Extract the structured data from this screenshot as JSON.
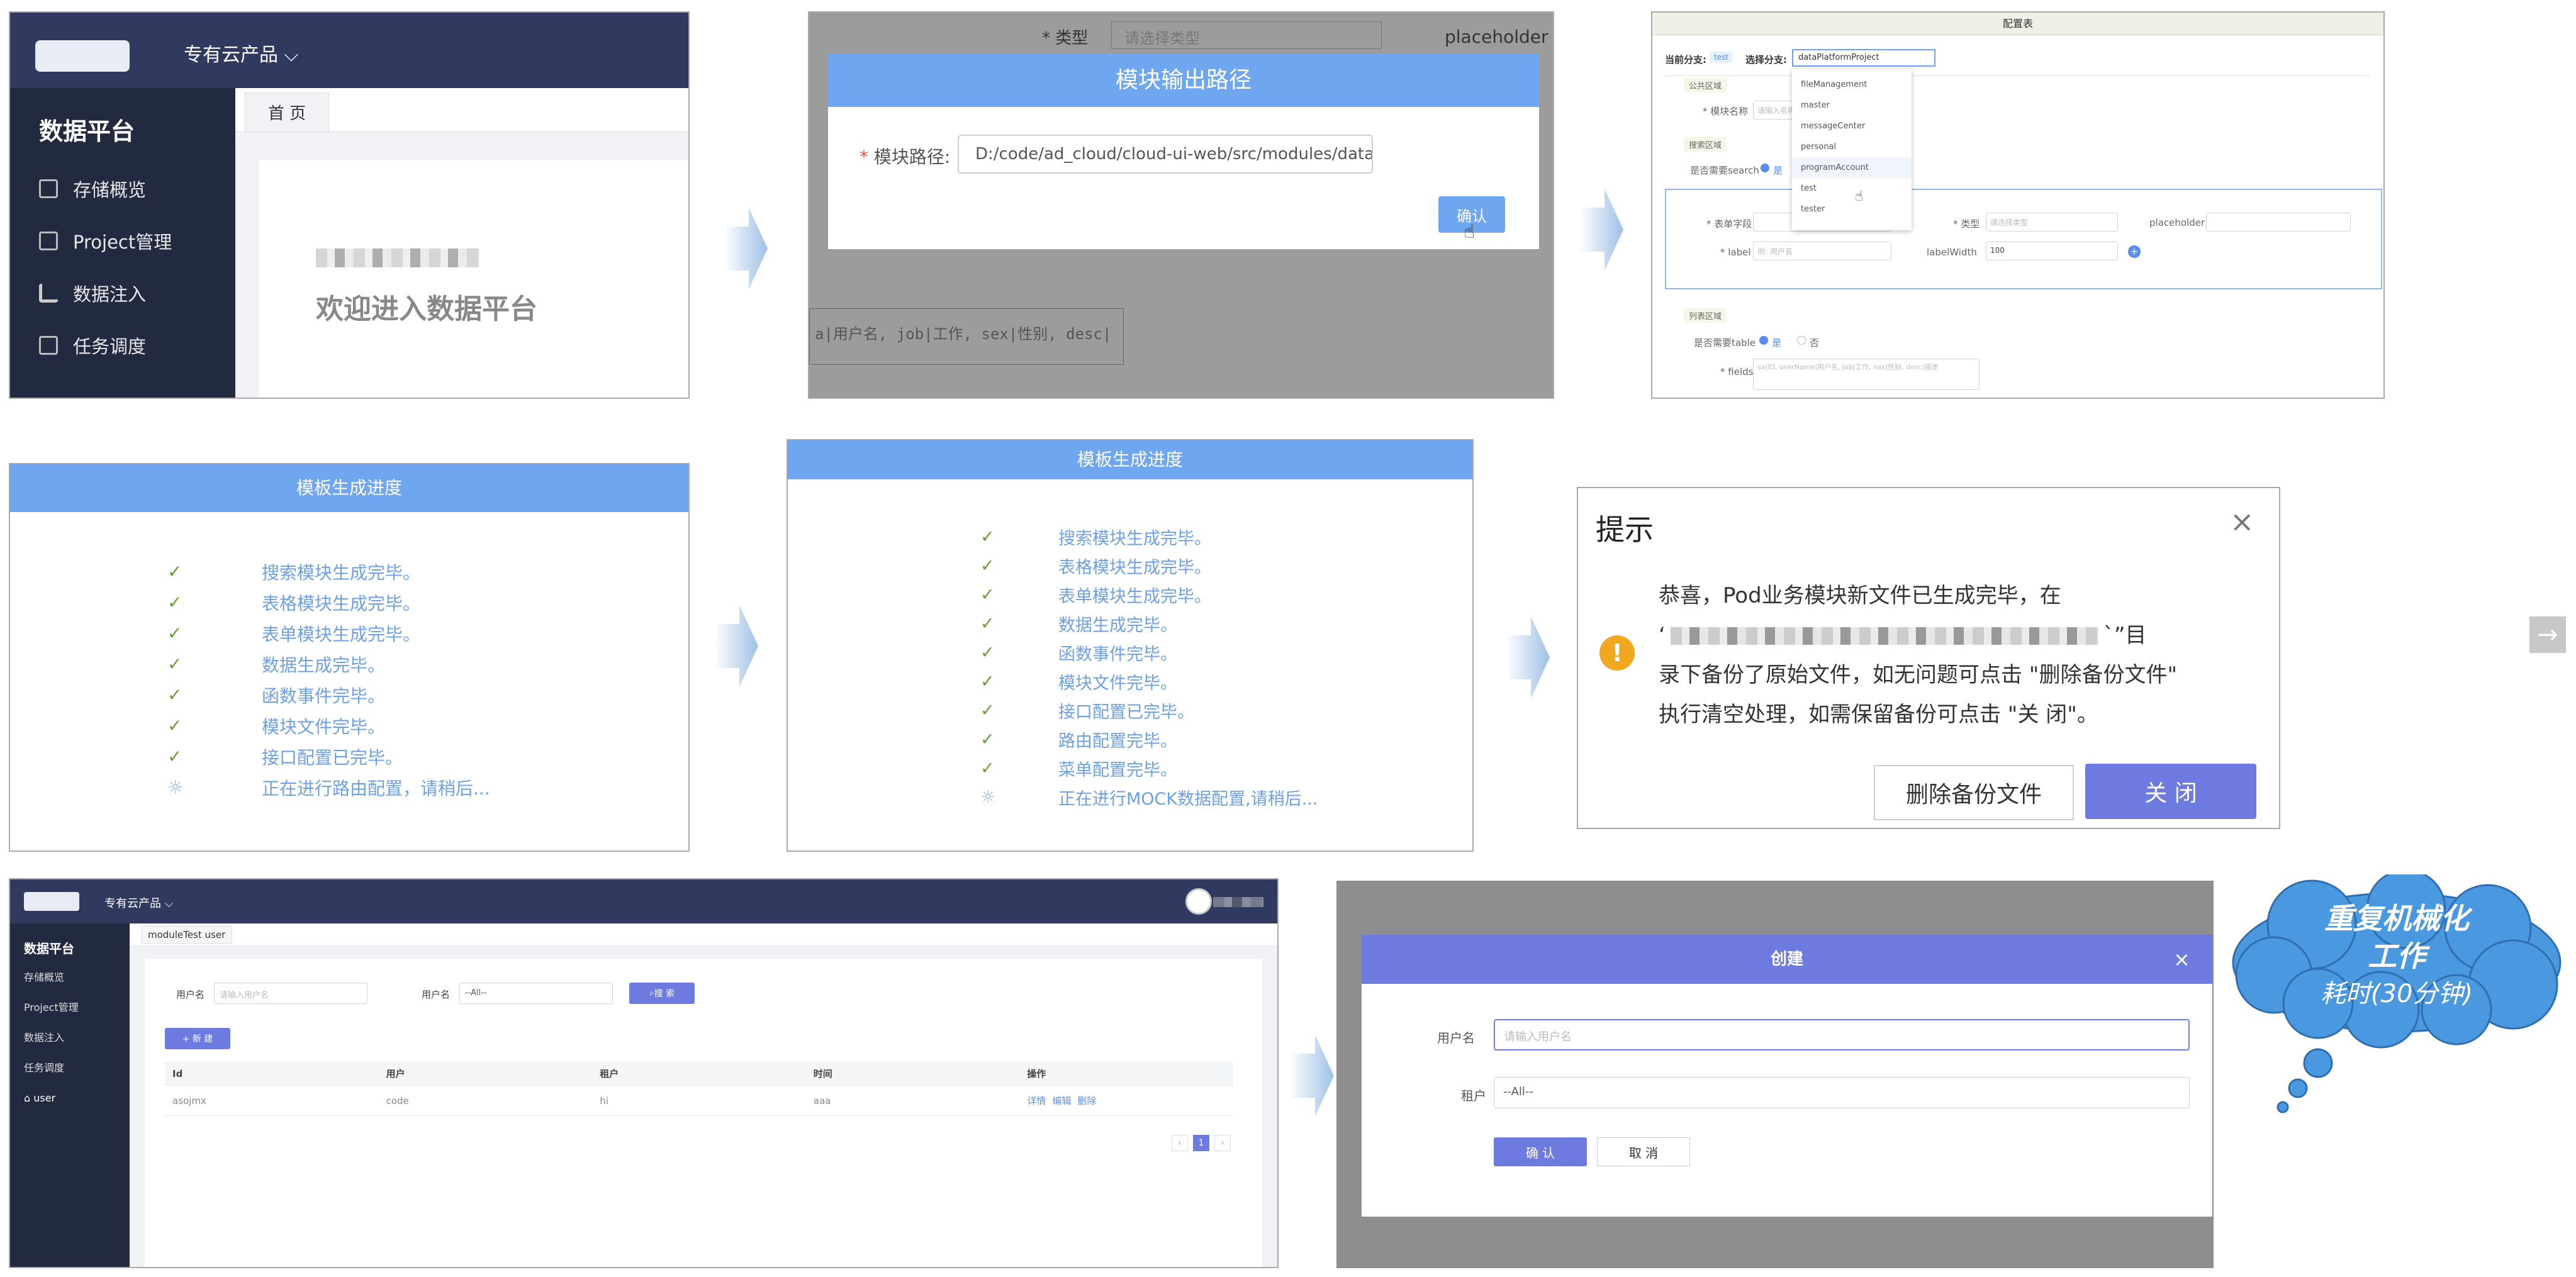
{
  "nav": {
    "prev": "←",
    "next": "→"
  },
  "panel1": {
    "product_menu": "专有云产品 ⌵",
    "side_title": "数据平台",
    "side_items": [
      "存储概览",
      "Project管理",
      "数据注入",
      "任务调度"
    ],
    "tab": "首 页",
    "welcome": "欢迎进入数据平台"
  },
  "panel2": {
    "bg_type_label": "* 类型",
    "bg_type_placeholder": "请选择类型",
    "bg_placeholder": "placeholder",
    "bg_fields": "a|用户名, job|工作, sex|性别, desc|",
    "dialog_title": "模块输出路径",
    "path_label": "模块路径:",
    "path_value": "D:/code/ad_cloud/cloud-ui-web/src/modules/data/pages",
    "confirm": "确认"
  },
  "panel3": {
    "title": "配置表",
    "current_branch_label": "当前分支:",
    "current_branch": "test",
    "select_branch_label": "选择分支:",
    "select_branch": "dataPlatformProject",
    "sections": [
      "公共区域",
      "搜索区域",
      "列表区域"
    ],
    "module_name_label": "* 模块名称",
    "module_name_ph": "请输入名称",
    "search_label": "是否需要search",
    "yes": "是",
    "no": "否",
    "form_label": "* 表单字段",
    "type_label": "* 类型",
    "type_ph": "请选择类型",
    "placeholder_label": "placeholder",
    "label_label": "* label",
    "label_ph": "例: 用户名",
    "labelwidth_label": "labelWidth",
    "labelwidth_value": "100",
    "table_label": "是否需要table",
    "fields_label": "* fields",
    "fields_ph": "sa|ID, userName|用户名, job|工作, sex|性别, desc|描述",
    "options": [
      "fileManagement",
      "master",
      "messageCenter",
      "personal",
      "programAccount",
      "test",
      "tester"
    ]
  },
  "panel4": {
    "title": "模板生成进度",
    "steps": [
      "搜索模块生成完毕。",
      "表格模块生成完毕。",
      "表单模块生成完毕。",
      "数据生成完毕。",
      "函数事件完毕。",
      "模块文件完毕。",
      "接口配置已完毕。"
    ],
    "loading": "正在进行路由配置，请稍后..."
  },
  "panel5": {
    "title": "模板生成进度",
    "steps": [
      "搜索模块生成完毕。",
      "表格模块生成完毕。",
      "表单模块生成完毕。",
      "数据生成完毕。",
      "函数事件完毕。",
      "模块文件完毕。",
      "接口配置已完毕。",
      "路由配置完毕。",
      "菜单配置完毕。"
    ],
    "loading": "正在进行MOCK数据配置,请稍后..."
  },
  "panel6": {
    "title": "提示",
    "line1": "恭喜，Pod业务模块新文件已生成完毕，在",
    "line2_prefix": "‘",
    "line2_suffix": "`”目",
    "line3": "录下备份了原始文件，如无问题可点击 \"删除备份文件\"",
    "line4": "执行清空处理，如需保留备份可点击 \"关 闭\"。",
    "delete_btn": "删除备份文件",
    "close_btn": "关 闭"
  },
  "panel7": {
    "product_menu": "专有云产品 ⌵",
    "side_title": "数据平台",
    "side_items": [
      "存储概览",
      "Project管理",
      "数据注入",
      "任务调度",
      "user"
    ],
    "tab": "moduleTest user",
    "username_label": "用户名",
    "username_ph": "请输入用户名",
    "tenant_label": "用户名",
    "tenant_value": "--All--",
    "search_btn": "搜 索",
    "new_btn": "+ 新 建",
    "columns": [
      "Id",
      "用户",
      "租户",
      "时间",
      "操作"
    ],
    "row": [
      "asojmx",
      "code",
      "hi",
      "aaa"
    ],
    "actions": [
      "详情",
      "编辑",
      "删除"
    ],
    "page": "1"
  },
  "panel8": {
    "title": "创建",
    "username_label": "用户名",
    "username_ph": "请输入用户名",
    "tenant_label": "租户",
    "tenant_value": "--All--",
    "confirm": "确 认",
    "cancel": "取 消"
  },
  "bubble": {
    "line1": "重复机械化",
    "line2": "工作",
    "line3": "耗时(30分钟)"
  },
  "colors": {
    "dialog_head": "#6ea6f0",
    "primary": "#6d7be0",
    "sidebar": "#222a3f",
    "topbar": "#303a5e",
    "bubble": "#4a98e0"
  }
}
